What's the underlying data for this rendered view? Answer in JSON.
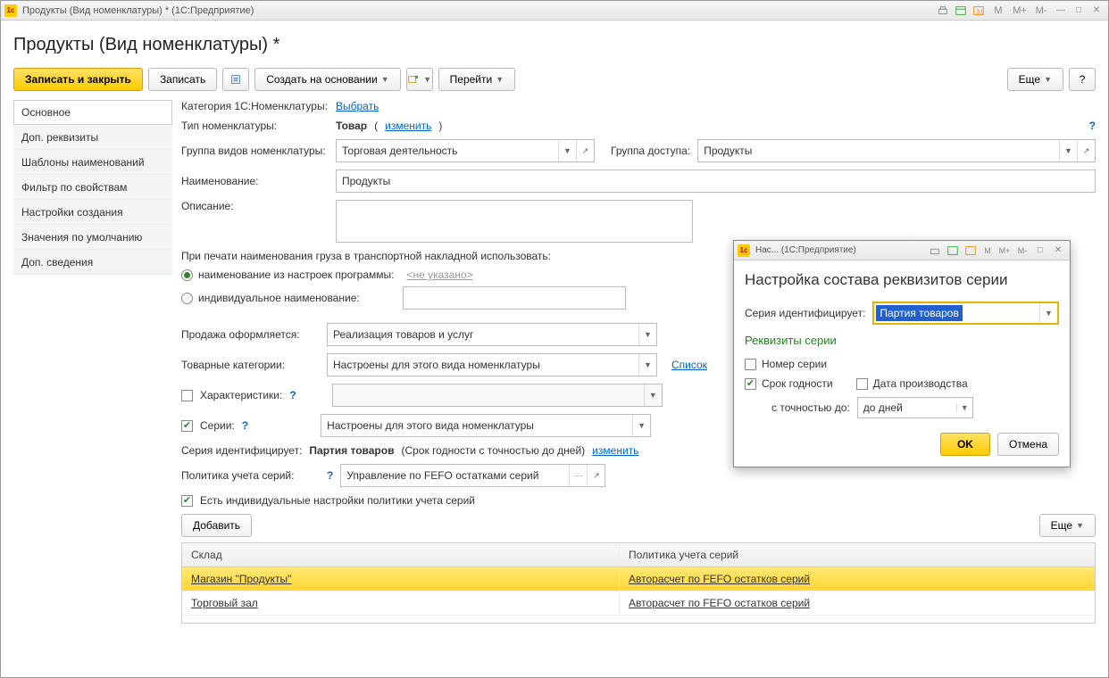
{
  "window": {
    "title": "Продукты (Вид номенклатуры) * (1С:Предприятие)",
    "tb_buttons": [
      "M",
      "M+",
      "M-"
    ]
  },
  "page_title": "Продукты (Вид номенклатуры) *",
  "toolbar": {
    "save_close": "Записать и закрыть",
    "save": "Записать",
    "create_based": "Создать на основании",
    "goto": "Перейти",
    "more": "Еще",
    "help": "?"
  },
  "sidebar": {
    "items": [
      "Основное",
      "Доп. реквизиты",
      "Шаблоны наименований",
      "Фильтр по свойствам",
      "Настройки создания",
      "Значения по умолчанию",
      "Доп. сведения"
    ]
  },
  "form": {
    "category_label": "Категория 1С:Номенклатуры:",
    "category_link": "Выбрать",
    "type_label": "Тип номенклатуры:",
    "type_value": "Товар",
    "type_change": "изменить",
    "group_kind_label": "Группа видов номенклатуры:",
    "group_kind_value": "Торговая деятельность",
    "access_group_label": "Группа доступа:",
    "access_group_value": "Продукты",
    "name_label": "Наименование:",
    "name_value": "Продукты",
    "desc_label": "Описание:",
    "print_label": "При печати наименования груза в транспортной накладной использовать:",
    "radio1": "наименование из настроек программы:",
    "radio1_hint": "<не указано>",
    "radio2": "индивидуальное наименование:",
    "sale_label": "Продажа оформляется:",
    "sale_value": "Реализация товаров и услуг",
    "cat_label": "Товарные категории:",
    "cat_value": "Настроены для этого вида номенклатуры",
    "cat_list": "Список",
    "char_label": "Характеристики:",
    "series_label": "Серии:",
    "series_value": "Настроены для этого вида номенклатуры",
    "series_id_label": "Серия идентифицирует:",
    "series_id_value": "Партия товаров",
    "series_id_extra": "(Срок годности с точностью до дней)",
    "series_id_change": "изменить",
    "policy_label": "Политика учета серий:",
    "policy_value": "Управление по FEFO остатками серий",
    "has_individual": "Есть индивидуальные настройки политики учета серий",
    "add_btn": "Добавить",
    "more_btn": "Еще"
  },
  "table": {
    "col1": "Склад",
    "col2": "Политика учета серий",
    "rows": [
      {
        "warehouse": "Магазин \"Продукты\"",
        "policy": "Авторасчет по FEFO остатков серий"
      },
      {
        "warehouse": "Торговый зал",
        "policy": "Авторасчет по FEFO остатков серий"
      }
    ]
  },
  "dialog": {
    "window_title": "Нас...  (1С:Предприятие)",
    "title": "Настройка состава реквизитов серии",
    "identifies_label": "Серия идентифицирует:",
    "identifies_value": "Партия товаров",
    "section": "Реквизиты серии",
    "cb_number": "Номер серии",
    "cb_expiry": "Срок годности",
    "cb_prod_date": "Дата производства",
    "precision_label": "с точностью до:",
    "precision_value": "до дней",
    "ok": "OK",
    "cancel": "Отмена"
  }
}
